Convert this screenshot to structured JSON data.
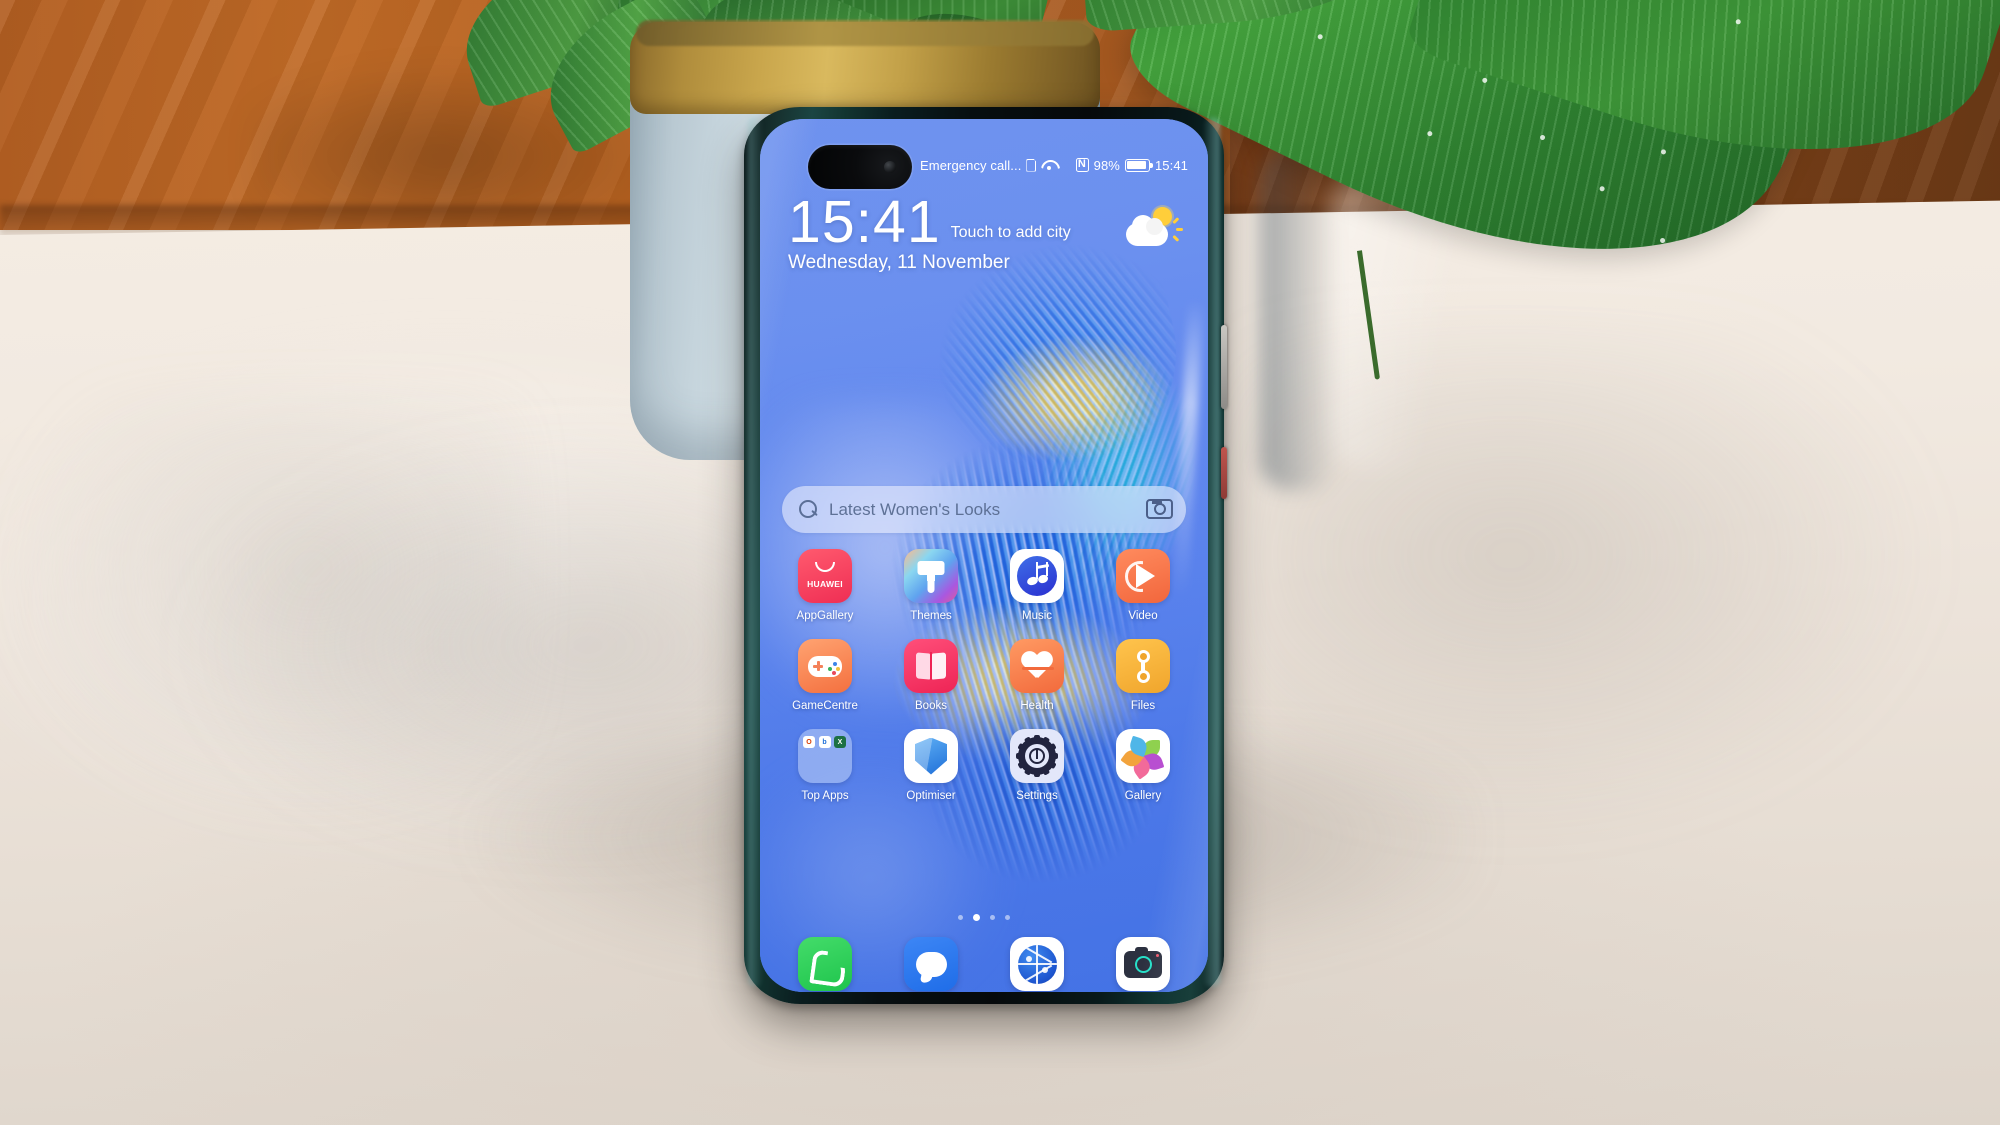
{
  "scene": {
    "description": "Huawei Mate 40 Pro smartphone standing upright on a cream table in front of a potted green plant against a wood-panelled wall",
    "surface": "cream-white table",
    "backdrop": "orange-brown wood panelling",
    "object": "blue-grey ceramic plant pot with gold-brown rim"
  },
  "phone": {
    "status_bar": {
      "carrier": "Emergency call...",
      "sim_icon": "sim-card-icon",
      "wifi_icon": "wifi-icon",
      "nfc_icon": "nfc-icon",
      "battery_percent": "98%",
      "battery_icon": "battery-full-icon",
      "clock": "15:41"
    },
    "clock_widget": {
      "time": "15:41",
      "city_hint": "Touch to add city",
      "date": "Wednesday, 11 November",
      "weather_icon": "partly-cloudy-icon"
    },
    "search_bar": {
      "search_icon": "search-icon",
      "text": "Latest Women's Looks",
      "camera_icon": "camera-lens-icon"
    },
    "app_grid": [
      {
        "label": "AppGallery",
        "icon": "appgallery-icon",
        "brand": "HUAWEI",
        "color": "#ef2e54"
      },
      {
        "label": "Themes",
        "icon": "themes-brush-icon",
        "color": "#8a5fe0"
      },
      {
        "label": "Music",
        "icon": "music-note-icon",
        "color": "#2a2fd0"
      },
      {
        "label": "Video",
        "icon": "video-play-icon",
        "color": "#f2663c"
      },
      {
        "label": "GameCentre",
        "icon": "gamepad-icon",
        "color": "#f4703f"
      },
      {
        "label": "Books",
        "icon": "open-book-icon",
        "color": "#ee2455"
      },
      {
        "label": "Health",
        "icon": "heart-pulse-icon",
        "color": "#f26a3c"
      },
      {
        "label": "Files",
        "icon": "files-icon",
        "color": "#f0a52c"
      },
      {
        "label": "Top Apps",
        "icon": "folder-icon",
        "color": "#d7e4fa"
      },
      {
        "label": "Optimiser",
        "icon": "shield-icon",
        "color": "#1f6fd8"
      },
      {
        "label": "Settings",
        "icon": "gear-icon",
        "color": "#22243f"
      },
      {
        "label": "Gallery",
        "icon": "gallery-pinwheel-icon",
        "color": "#9a3fd0"
      }
    ],
    "folder_mini_icons": [
      {
        "name": "office-icon",
        "glyph": "O",
        "color": "#d83b01"
      },
      {
        "name": "bing-icon",
        "glyph": "b",
        "color": "#1f6fd8"
      },
      {
        "name": "excel-icon",
        "glyph": "X",
        "color": "#1d7044"
      }
    ],
    "dock": [
      {
        "label": "Phone",
        "icon": "phone-icon",
        "color": "#1ec44c"
      },
      {
        "label": "Messages",
        "icon": "message-icon",
        "color": "#1f6de8"
      },
      {
        "label": "Browser",
        "icon": "globe-icon",
        "color": "#1d55cf"
      },
      {
        "label": "Camera",
        "icon": "camera-icon",
        "color": "#2c3140"
      }
    ],
    "page_indicator": {
      "total": 4,
      "active": 2
    },
    "hardware": {
      "punch_hole": "dual-front-camera-cutout",
      "volume_button": "volume-rocker",
      "power_button": "power-button"
    }
  }
}
